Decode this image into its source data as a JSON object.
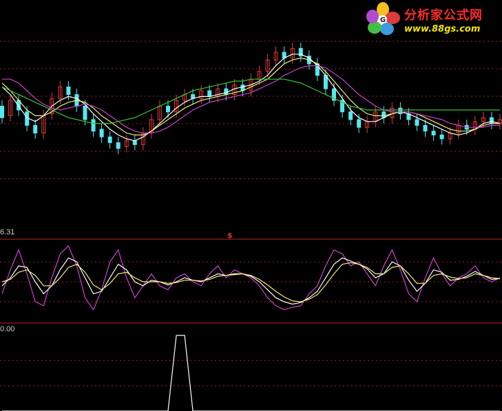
{
  "logo": {
    "title": "分析家公式网",
    "url": "www.88gs.com"
  },
  "colors": {
    "background": "#000000",
    "up_candle": "#e23a3a",
    "down_candle": "#54e8f0",
    "ma_white": "#ffffff",
    "ma_yellow": "#f0f07a",
    "ma_magenta": "#d040d0",
    "ma_green": "#32c832",
    "separator": "#c82020",
    "gridline": "#a02020"
  },
  "panels": {
    "oscillator": {
      "top_label": "6.31",
      "marker": "$"
    },
    "signal": {
      "top_label": "0.00"
    }
  },
  "chart_data": [
    {
      "type": "candlestick",
      "series": [
        {
          "color": "white",
          "values": [
            0.62,
            0.58,
            0.52,
            0.46,
            0.44,
            0.47,
            0.52,
            0.55,
            0.57,
            0.56,
            0.53,
            0.48,
            0.44,
            0.4,
            0.37,
            0.35,
            0.34,
            0.36,
            0.39,
            0.43,
            0.47,
            0.51,
            0.54,
            0.56,
            0.57,
            0.57,
            0.58,
            0.59,
            0.61,
            0.62,
            0.63,
            0.65,
            0.68,
            0.73,
            0.77,
            0.79,
            0.79,
            0.77,
            0.73,
            0.68,
            0.62,
            0.56,
            0.5,
            0.46,
            0.44,
            0.44,
            0.46,
            0.48,
            0.49,
            0.48,
            0.46,
            0.44,
            0.42,
            0.4,
            0.38,
            0.37,
            0.38,
            0.4,
            0.43,
            0.44,
            0.43
          ]
        },
        {
          "color": "yellow",
          "values": [
            0.64,
            0.6,
            0.55,
            0.5,
            0.47,
            0.47,
            0.49,
            0.52,
            0.54,
            0.55,
            0.54,
            0.51,
            0.47,
            0.44,
            0.41,
            0.38,
            0.37,
            0.37,
            0.39,
            0.42,
            0.45,
            0.48,
            0.51,
            0.53,
            0.55,
            0.56,
            0.57,
            0.58,
            0.59,
            0.6,
            0.62,
            0.64,
            0.66,
            0.7,
            0.74,
            0.76,
            0.77,
            0.76,
            0.74,
            0.7,
            0.65,
            0.6,
            0.55,
            0.51,
            0.48,
            0.47,
            0.47,
            0.48,
            0.49,
            0.49,
            0.48,
            0.46,
            0.44,
            0.42,
            0.4,
            0.39,
            0.39,
            0.4,
            0.42,
            0.43,
            0.43
          ]
        },
        {
          "color": "magenta",
          "values": [
            0.66,
            0.66,
            0.64,
            0.6,
            0.56,
            0.53,
            0.51,
            0.5,
            0.51,
            0.52,
            0.53,
            0.52,
            0.5,
            0.47,
            0.44,
            0.41,
            0.39,
            0.38,
            0.38,
            0.39,
            0.41,
            0.44,
            0.47,
            0.5,
            0.52,
            0.54,
            0.55,
            0.56,
            0.57,
            0.58,
            0.59,
            0.61,
            0.63,
            0.65,
            0.68,
            0.7,
            0.72,
            0.73,
            0.73,
            0.72,
            0.69,
            0.66,
            0.62,
            0.58,
            0.55,
            0.52,
            0.5,
            0.49,
            0.49,
            0.49,
            0.48,
            0.47,
            0.46,
            0.45,
            0.43,
            0.42,
            0.41,
            0.41,
            0.41,
            0.42,
            0.42
          ]
        },
        {
          "color": "green",
          "values": [
            0.62,
            0.6,
            0.58,
            0.56,
            0.54,
            0.52,
            0.5,
            0.48,
            0.46,
            0.45,
            0.44,
            0.43,
            0.43,
            0.43,
            0.44,
            0.45,
            0.46,
            0.48,
            0.5,
            0.52,
            0.54,
            0.56,
            0.58,
            0.6,
            0.61,
            0.62,
            0.63,
            0.64,
            0.65,
            0.65,
            0.66,
            0.66,
            0.66,
            0.66,
            0.66,
            0.65,
            0.64,
            0.62,
            0.6,
            0.58,
            0.56,
            0.54,
            0.52,
            0.51,
            0.5,
            0.5,
            0.5,
            0.5,
            0.5,
            0.5,
            0.5,
            0.5,
            0.5,
            0.5,
            0.5,
            0.5,
            0.5,
            0.5,
            0.5,
            0.5,
            0.5
          ]
        }
      ],
      "candles": [
        [
          0.52,
          0.46
        ],
        [
          0.47,
          0.55
        ],
        [
          0.55,
          0.5
        ],
        [
          0.49,
          0.42
        ],
        [
          0.42,
          0.38
        ],
        [
          0.38,
          0.47
        ],
        [
          0.48,
          0.56
        ],
        [
          0.56,
          0.62
        ],
        [
          0.62,
          0.58
        ],
        [
          0.58,
          0.52
        ],
        [
          0.52,
          0.45
        ],
        [
          0.45,
          0.39
        ],
        [
          0.4,
          0.36
        ],
        [
          0.36,
          0.33
        ],
        [
          0.33,
          0.3
        ],
        [
          0.31,
          0.34
        ],
        [
          0.34,
          0.32
        ],
        [
          0.32,
          0.38
        ],
        [
          0.38,
          0.45
        ],
        [
          0.45,
          0.52
        ],
        [
          0.52,
          0.49
        ],
        [
          0.49,
          0.55
        ],
        [
          0.55,
          0.58
        ],
        [
          0.58,
          0.56
        ],
        [
          0.56,
          0.6
        ],
        [
          0.6,
          0.57
        ],
        [
          0.57,
          0.61
        ],
        [
          0.61,
          0.58
        ],
        [
          0.58,
          0.63
        ],
        [
          0.63,
          0.6
        ],
        [
          0.6,
          0.66
        ],
        [
          0.66,
          0.7
        ],
        [
          0.7,
          0.76
        ],
        [
          0.76,
          0.8
        ],
        [
          0.8,
          0.77
        ],
        [
          0.77,
          0.82
        ],
        [
          0.82,
          0.78
        ],
        [
          0.78,
          0.74
        ],
        [
          0.74,
          0.68
        ],
        [
          0.68,
          0.61
        ],
        [
          0.61,
          0.55
        ],
        [
          0.55,
          0.49
        ],
        [
          0.49,
          0.45
        ],
        [
          0.45,
          0.41
        ],
        [
          0.41,
          0.44
        ],
        [
          0.44,
          0.49
        ],
        [
          0.49,
          0.46
        ],
        [
          0.46,
          0.51
        ],
        [
          0.51,
          0.48
        ],
        [
          0.48,
          0.45
        ],
        [
          0.45,
          0.42
        ],
        [
          0.42,
          0.39
        ],
        [
          0.39,
          0.37
        ],
        [
          0.37,
          0.35
        ],
        [
          0.35,
          0.38
        ],
        [
          0.38,
          0.42
        ],
        [
          0.42,
          0.4
        ],
        [
          0.4,
          0.44
        ],
        [
          0.44,
          0.46
        ],
        [
          0.46,
          0.43
        ],
        [
          0.43,
          0.45
        ]
      ]
    },
    {
      "type": "line",
      "series": [
        {
          "color": "magenta",
          "values": [
            0.35,
            0.65,
            0.9,
            0.6,
            0.25,
            0.2,
            0.55,
            0.85,
            0.95,
            0.7,
            0.3,
            0.15,
            0.4,
            0.75,
            0.9,
            0.55,
            0.3,
            0.45,
            0.6,
            0.45,
            0.4,
            0.55,
            0.6,
            0.5,
            0.45,
            0.6,
            0.7,
            0.55,
            0.65,
            0.6,
            0.55,
            0.45,
            0.3,
            0.2,
            0.15,
            0.18,
            0.2,
            0.35,
            0.45,
            0.7,
            0.9,
            0.85,
            0.7,
            0.75,
            0.6,
            0.45,
            0.7,
            0.9,
            0.65,
            0.35,
            0.25,
            0.55,
            0.8,
            0.6,
            0.45,
            0.55,
            0.6,
            0.7,
            0.55,
            0.5,
            0.55
          ]
        },
        {
          "color": "white",
          "values": [
            0.45,
            0.55,
            0.7,
            0.68,
            0.5,
            0.35,
            0.45,
            0.65,
            0.8,
            0.75,
            0.55,
            0.35,
            0.38,
            0.55,
            0.72,
            0.65,
            0.5,
            0.45,
            0.52,
            0.5,
            0.46,
            0.5,
            0.55,
            0.52,
            0.5,
            0.55,
            0.6,
            0.58,
            0.6,
            0.6,
            0.57,
            0.5,
            0.4,
            0.3,
            0.25,
            0.22,
            0.24,
            0.3,
            0.38,
            0.55,
            0.72,
            0.8,
            0.76,
            0.72,
            0.66,
            0.55,
            0.6,
            0.75,
            0.7,
            0.52,
            0.38,
            0.48,
            0.65,
            0.62,
            0.52,
            0.53,
            0.57,
            0.63,
            0.58,
            0.53,
            0.54
          ]
        },
        {
          "color": "yellow",
          "values": [
            0.5,
            0.53,
            0.62,
            0.65,
            0.58,
            0.45,
            0.45,
            0.55,
            0.68,
            0.72,
            0.62,
            0.46,
            0.4,
            0.48,
            0.6,
            0.62,
            0.55,
            0.5,
            0.5,
            0.5,
            0.48,
            0.49,
            0.52,
            0.52,
            0.51,
            0.53,
            0.57,
            0.58,
            0.59,
            0.6,
            0.58,
            0.53,
            0.46,
            0.38,
            0.31,
            0.26,
            0.25,
            0.28,
            0.34,
            0.46,
            0.6,
            0.72,
            0.74,
            0.72,
            0.68,
            0.6,
            0.6,
            0.68,
            0.7,
            0.6,
            0.48,
            0.48,
            0.58,
            0.6,
            0.56,
            0.54,
            0.55,
            0.6,
            0.58,
            0.55,
            0.54
          ]
        }
      ]
    },
    {
      "type": "line",
      "series": [
        {
          "color": "white",
          "values": [
            0,
            0,
            0,
            0,
            0,
            0,
            0,
            0,
            0,
            0,
            0,
            0,
            0,
            0,
            0,
            0,
            0,
            0,
            0,
            0,
            0,
            1,
            1,
            0,
            0,
            0,
            0,
            0,
            0,
            0,
            0,
            0,
            0,
            0,
            0,
            0,
            0,
            0,
            0,
            0,
            0,
            0,
            0,
            0,
            0,
            0,
            0,
            0,
            0,
            0,
            0,
            0,
            0,
            0,
            0,
            0,
            0,
            0,
            0,
            0,
            0
          ]
        }
      ]
    }
  ]
}
